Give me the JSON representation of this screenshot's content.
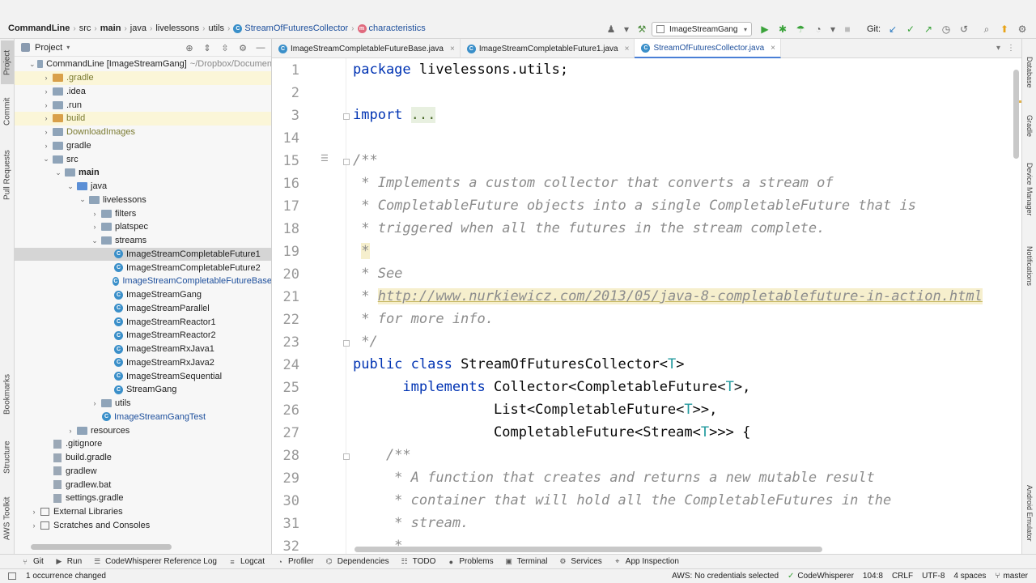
{
  "breadcrumbs": {
    "project": "CommandLine",
    "src": "src",
    "main": "main",
    "java": "java",
    "livelessons": "livelessons",
    "utils": "utils",
    "class": "StreamOfFuturesCollector",
    "method": "characteristics"
  },
  "toolbar": {
    "run_config": "ImageStreamGang",
    "git_label": "Git:"
  },
  "left_tabs": [
    "Project",
    "Commit",
    "Pull Requests",
    "Bookmarks",
    "Structure",
    "AWS Toolkit"
  ],
  "right_tabs": [
    "Database",
    "Gradle",
    "Device Manager",
    "Notifications",
    "Android Emulator"
  ],
  "project_panel": {
    "title": "Project",
    "tree": [
      {
        "label": "CommandLine [ImageStreamGang]",
        "extra": "~/Dropbox/Documen",
        "depth": 0,
        "chev": "v",
        "icon": "folder"
      },
      {
        "label": ".gradle",
        "depth": 1,
        "chev": ">",
        "icon": "orange",
        "style": "olive",
        "bg": "yellow"
      },
      {
        "label": ".idea",
        "depth": 1,
        "chev": ">",
        "icon": "folder"
      },
      {
        "label": ".run",
        "depth": 1,
        "chev": ">",
        "icon": "folder"
      },
      {
        "label": "build",
        "depth": 1,
        "chev": ">",
        "icon": "orange",
        "style": "olive",
        "bg": "yellow"
      },
      {
        "label": "DownloadImages",
        "depth": 1,
        "chev": ">",
        "icon": "folder",
        "style": "olive"
      },
      {
        "label": "gradle",
        "depth": 1,
        "chev": ">",
        "icon": "folder"
      },
      {
        "label": "src",
        "depth": 1,
        "chev": "v",
        "icon": "folder"
      },
      {
        "label": "main",
        "depth": 2,
        "chev": "v",
        "icon": "folder",
        "style": "bold"
      },
      {
        "label": "java",
        "depth": 3,
        "chev": "v",
        "icon": "blue"
      },
      {
        "label": "livelessons",
        "depth": 4,
        "chev": "v",
        "icon": "folder"
      },
      {
        "label": "filters",
        "depth": 5,
        "chev": ">",
        "icon": "folder"
      },
      {
        "label": "platspec",
        "depth": 5,
        "chev": ">",
        "icon": "folder"
      },
      {
        "label": "streams",
        "depth": 5,
        "chev": "v",
        "icon": "folder"
      },
      {
        "label": "ImageStreamCompletableFuture1",
        "depth": 6,
        "chev": "",
        "icon": "class",
        "bg": "sel"
      },
      {
        "label": "ImageStreamCompletableFuture2",
        "depth": 6,
        "chev": "",
        "icon": "class"
      },
      {
        "label": "ImageStreamCompletableFutureBase",
        "depth": 6,
        "chev": "",
        "icon": "class",
        "style": "blue"
      },
      {
        "label": "ImageStreamGang",
        "depth": 6,
        "chev": "",
        "icon": "class"
      },
      {
        "label": "ImageStreamParallel",
        "depth": 6,
        "chev": "",
        "icon": "class"
      },
      {
        "label": "ImageStreamReactor1",
        "depth": 6,
        "chev": "",
        "icon": "class"
      },
      {
        "label": "ImageStreamReactor2",
        "depth": 6,
        "chev": "",
        "icon": "class"
      },
      {
        "label": "ImageStreamRxJava1",
        "depth": 6,
        "chev": "",
        "icon": "class"
      },
      {
        "label": "ImageStreamRxJava2",
        "depth": 6,
        "chev": "",
        "icon": "class"
      },
      {
        "label": "ImageStreamSequential",
        "depth": 6,
        "chev": "",
        "icon": "class"
      },
      {
        "label": "StreamGang",
        "depth": 6,
        "chev": "",
        "icon": "class"
      },
      {
        "label": "utils",
        "depth": 5,
        "chev": ">",
        "icon": "folder"
      },
      {
        "label": "ImageStreamGangTest",
        "depth": 5,
        "chev": "",
        "icon": "class",
        "style": "blue"
      },
      {
        "label": "resources",
        "depth": 3,
        "chev": ">",
        "icon": "folder"
      },
      {
        "label": ".gitignore",
        "depth": 1,
        "chev": "",
        "icon": "file"
      },
      {
        "label": "build.gradle",
        "depth": 1,
        "chev": "",
        "icon": "file"
      },
      {
        "label": "gradlew",
        "depth": 1,
        "chev": "",
        "icon": "file"
      },
      {
        "label": "gradlew.bat",
        "depth": 1,
        "chev": "",
        "icon": "file"
      },
      {
        "label": "settings.gradle",
        "depth": 1,
        "chev": "",
        "icon": "file"
      },
      {
        "label": "External Libraries",
        "depth": 0,
        "chev": ">",
        "icon": "lib"
      },
      {
        "label": "Scratches and Consoles",
        "depth": 0,
        "chev": ">",
        "icon": "lib"
      }
    ]
  },
  "editor_tabs": [
    {
      "label": "ImageStreamCompletableFutureBase.java",
      "active": false
    },
    {
      "label": "ImageStreamCompletableFuture1.java",
      "active": false
    },
    {
      "label": "StreamOfFuturesCollector.java",
      "active": true
    }
  ],
  "code": [
    {
      "n": "1",
      "html": "<span class=\"kw\">package</span> livelessons.utils;"
    },
    {
      "n": "2",
      "html": ""
    },
    {
      "n": "3",
      "html": "<span class=\"kw\">import</span> <span class=\"fold-hl\">...</span>"
    },
    {
      "n": "14",
      "html": ""
    },
    {
      "n": "15",
      "html": "<span class=\"cm\">/**</span>"
    },
    {
      "n": "16",
      "html": "<span class=\"cm\"> * Implements a custom collector that converts a stream of</span>"
    },
    {
      "n": "17",
      "html": "<span class=\"cm\"> * CompletableFuture objects into a single CompletableFuture that is</span>"
    },
    {
      "n": "18",
      "html": "<span class=\"cm\"> * triggered when all the futures in the stream complete.</span>"
    },
    {
      "n": "19",
      "html": "<span class=\"cm\"> </span><span class=\"cm\" style=\"background:#f6efcd\">*</span>"
    },
    {
      "n": "20",
      "html": "<span class=\"cm\"> * See</span>"
    },
    {
      "n": "21",
      "html": "<span class=\"cm\"> * </span><span class=\"url\">http://www.nurkiewicz.com/2013/05/java-8-completablefuture-in-action.html</span>"
    },
    {
      "n": "22",
      "html": "<span class=\"cm\"> * for more info.</span>"
    },
    {
      "n": "23",
      "html": "<span class=\"cm\"> */</span>"
    },
    {
      "n": "24",
      "html": "<span class=\"kw\">public class</span> StreamOfFuturesCollector&lt;<span class=\"tp\">T</span>&gt;"
    },
    {
      "n": "25",
      "html": "      <span class=\"kw\">implements</span> Collector&lt;CompletableFuture&lt;<span class=\"tp\">T</span>&gt;,"
    },
    {
      "n": "26",
      "html": "                 List&lt;CompletableFuture&lt;<span class=\"tp\">T</span>&gt;&gt;,"
    },
    {
      "n": "27",
      "html": "                 CompletableFuture&lt;Stream&lt;<span class=\"tp\">T</span>&gt;&gt;&gt; {"
    },
    {
      "n": "28",
      "html": "    <span class=\"cm\">/**</span>"
    },
    {
      "n": "29",
      "html": "<span class=\"cm\">     * A function that creates and returns a new mutable result</span>"
    },
    {
      "n": "30",
      "html": "<span class=\"cm\">     * container that will hold all the CompletableFutures in the</span>"
    },
    {
      "n": "31",
      "html": "<span class=\"cm\">     * stream.</span>"
    },
    {
      "n": "32",
      "html": "<span class=\"cm\">     *</span>"
    }
  ],
  "bottom_tools": [
    "Git",
    "Run",
    "CodeWhisperer Reference Log",
    "Logcat",
    "Profiler",
    "Dependencies",
    "TODO",
    "Problems",
    "Terminal",
    "Services",
    "App Inspection"
  ],
  "status": {
    "message": "1 occurrence changed",
    "aws": "AWS: No credentials selected",
    "codewhisperer": "CodeWhisperer",
    "position": "104:8",
    "line_sep": "CRLF",
    "encoding": "UTF-8",
    "indent": "4 spaces",
    "branch": "master"
  }
}
